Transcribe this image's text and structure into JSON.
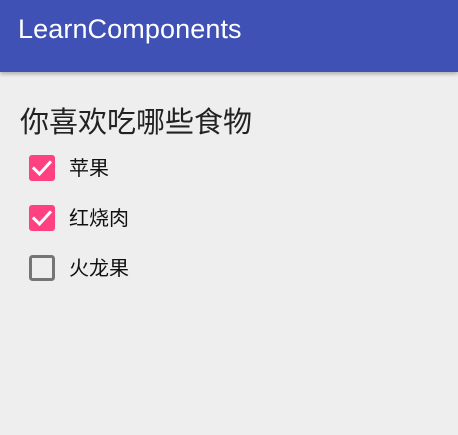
{
  "app_bar": {
    "title": "LearnComponents",
    "color": "#3f51b5"
  },
  "question": {
    "text": "你喜欢吃哪些食物"
  },
  "options": [
    {
      "label": "苹果",
      "checked": true
    },
    {
      "label": "红烧肉",
      "checked": true
    },
    {
      "label": "火龙果",
      "checked": false
    }
  ],
  "colors": {
    "accent": "#ff4081",
    "unchecked_border": "#757575",
    "background": "#eeeeee"
  },
  "icons": {
    "checked": "checkbox-checked-icon",
    "unchecked": "checkbox-unchecked-icon"
  }
}
